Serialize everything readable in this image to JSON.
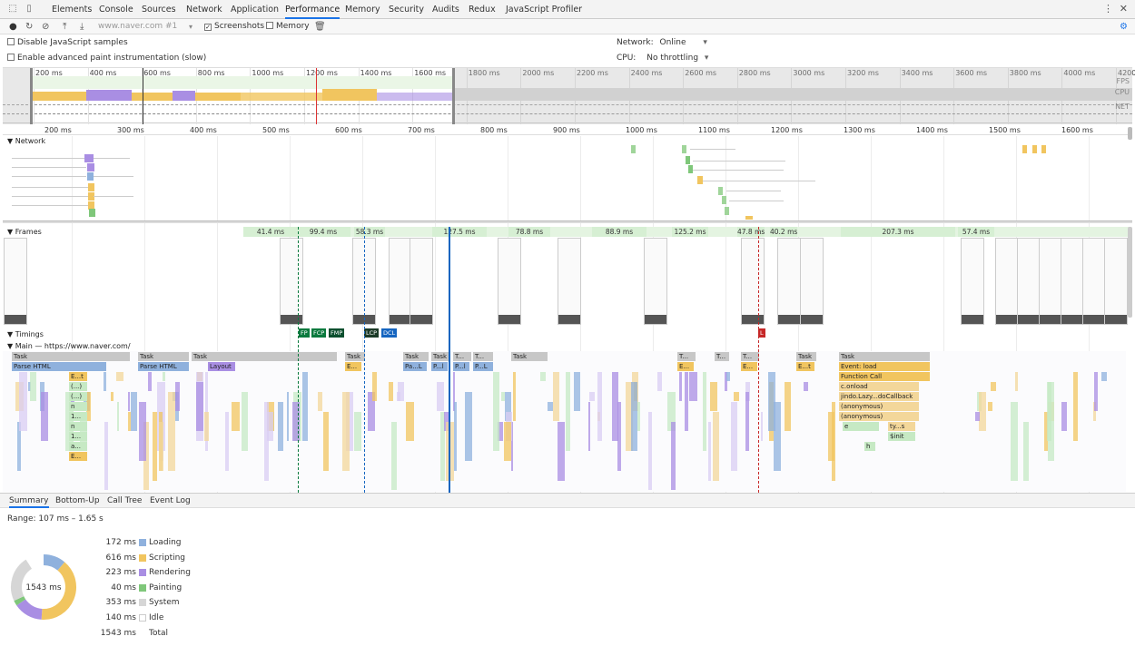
{
  "tabs": [
    "Elements",
    "Console",
    "Sources",
    "Network",
    "Application",
    "Performance",
    "Memory",
    "Security",
    "Audits",
    "Redux",
    "JavaScript Profiler"
  ],
  "active_tab": "Performance",
  "toolbar": {
    "url": "www.naver.com #1",
    "screenshots_label": "Screenshots",
    "memory_label": "Memory"
  },
  "settings": {
    "disable_js_samples": "Disable JavaScript samples",
    "enable_paint": "Enable advanced paint instrumentation (slow)",
    "network_label": "Network:",
    "network_value": "Online",
    "cpu_label": "CPU:",
    "cpu_value": "No throttling"
  },
  "overview": {
    "ticks": [
      "200 ms",
      "400 ms",
      "600 ms",
      "800 ms",
      "1000 ms",
      "1200 ms",
      "1400 ms",
      "1600 ms",
      "1800 ms",
      "2000 ms",
      "2200 ms",
      "2400 ms",
      "2600 ms",
      "2800 ms",
      "3000 ms",
      "3200 ms",
      "3400 ms",
      "3600 ms",
      "3800 ms",
      "4000 ms",
      "4200"
    ],
    "labels": {
      "fps": "FPS",
      "cpu": "CPU",
      "net": "NET"
    }
  },
  "ruler": [
    "200 ms",
    "300 ms",
    "400 ms",
    "500 ms",
    "600 ms",
    "700 ms",
    "800 ms",
    "900 ms",
    "1000 ms",
    "1100 ms",
    "1200 ms",
    "1300 ms",
    "1400 ms",
    "1500 ms",
    "1600 ms"
  ],
  "sections": {
    "network": "Network",
    "frames": "Frames",
    "timings": "Timings",
    "main": "Main — https://www.naver.com/"
  },
  "frames": [
    "41.4 ms",
    "99.4 ms",
    "58.3 ms",
    "127.5 ms",
    "78.8 ms",
    "88.9 ms",
    "125.2 ms",
    "47.8 ms",
    "40.2 ms",
    "207.3 ms",
    "57.4 ms"
  ],
  "timing_marks": [
    "FP",
    "FCP",
    "FMP",
    "LCP",
    "DCL",
    "L"
  ],
  "main": {
    "tasks": [
      "Task",
      "Task",
      "Task",
      "Task",
      "Task",
      "Task",
      "T...",
      "T...",
      "Task",
      "T...",
      "T...",
      "T...",
      "Task",
      "Task"
    ],
    "row2": [
      "Parse HTML",
      "Parse HTML",
      "Layout",
      "E...",
      "Pa...L",
      "P...l",
      "P...l",
      "P...L",
      "E...",
      "E...",
      "E...t",
      "Event: load"
    ],
    "stack": [
      "Function Call",
      "c.onload",
      "jindo.Lazy...doCallback",
      "(anonymous)",
      "(anonymous)",
      "e",
      "ty...s",
      "$init",
      "h"
    ],
    "left_stack": [
      "E...t",
      "(...)",
      "(...)",
      "n",
      "1...",
      "n",
      "1...",
      "a...",
      "E..."
    ]
  },
  "bottom_tabs": [
    "Summary",
    "Bottom-Up",
    "Call Tree",
    "Event Log"
  ],
  "summary": {
    "range": "Range: 107 ms – 1.65 s",
    "total_center": "1543 ms",
    "rows": [
      {
        "ms": "172 ms",
        "name": "Loading",
        "color": "#8fb1dd",
        "value": 172
      },
      {
        "ms": "616 ms",
        "name": "Scripting",
        "color": "#f1c55f",
        "value": 616
      },
      {
        "ms": "223 ms",
        "name": "Rendering",
        "color": "#a98ee3",
        "value": 223
      },
      {
        "ms": "40 ms",
        "name": "Painting",
        "color": "#7fc77a",
        "value": 40
      },
      {
        "ms": "353 ms",
        "name": "System",
        "color": "#d6d6d6",
        "value": 353
      },
      {
        "ms": "140 ms",
        "name": "Idle",
        "color": "#ffffff",
        "value": 140
      },
      {
        "ms": "1543 ms",
        "name": "Total",
        "color": "",
        "value": 1543
      }
    ]
  }
}
